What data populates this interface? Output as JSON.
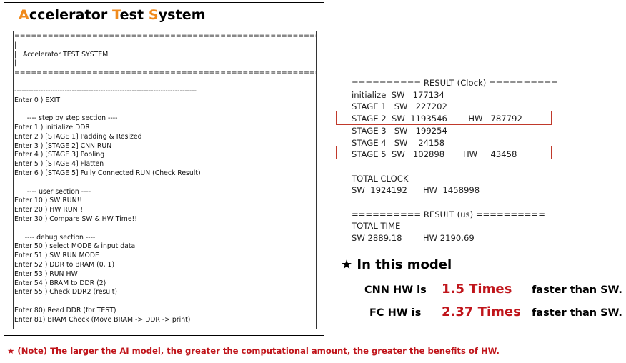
{
  "title": {
    "a": "A",
    "accelerator": "ccelerator ",
    "t": "T",
    "est": "est ",
    "s": "S",
    "ystem": "ystem"
  },
  "console": {
    "lines": [
      "==============================================================",
      "|",
      "|   Accelerator TEST SYSTEM",
      "|",
      "==============================================================",
      "",
      "----------------------------------------------------------------------------",
      "Enter 0 ) EXIT",
      "",
      "      ---- step by step section ----",
      "Enter 1 ) initialize DDR",
      "Enter 2 ) [STAGE 1] Padding & Resized",
      "Enter 3 ) [STAGE 2] CNN RUN",
      "Enter 4 ) [STAGE 3] Pooling",
      "Enter 5 ) [STAGE 4] Flatten",
      "Enter 6 ) [STAGE 5] Fully Connected RUN (Check Result)",
      "",
      "      ---- user section ----",
      "Enter 10 ) SW RUN!!",
      "Enter 20 ) HW RUN!!",
      "Enter 30 ) Compare SW & HW Time!!",
      "",
      "     ---- debug section ----",
      "Enter 50 ) select MODE & input data",
      "Enter 51 ) SW RUN MODE",
      "Enter 52 ) DDR to BRAM (0, 1)",
      "Enter 53 ) RUN HW",
      "Enter 54 ) BRAM to DDR (2)",
      "Enter 55 ) Check DDR2 (result)",
      "",
      "Enter 80) Read DDR (for TEST)",
      "Enter 81) BRAM Check (Move BRAM -> DDR -> print)"
    ]
  },
  "result": {
    "lines": [
      "========== RESULT (Clock) ==========",
      "initialize  SW   177134",
      "STAGE 1   SW   227202",
      "STAGE 2  SW  1193546        HW   787792",
      "STAGE 3   SW   199254",
      "STAGE 4   SW    24158",
      "STAGE 5  SW   102898       HW     43458",
      "",
      "TOTAL CLOCK",
      "SW  1924192      HW  1458998",
      "",
      "========== RESULT (us) ==========",
      "TOTAL TIME",
      "SW 2889.18        HW 2190.69"
    ],
    "highlight_color": "#c0392b"
  },
  "model": {
    "heading": "★ In this model",
    "rows": [
      {
        "label": "CNN HW is",
        "value": "1.5 Times",
        "tail": "faster than SW."
      },
      {
        "label": "FC   HW is",
        "value": "2.37 Times",
        "tail": "faster than SW."
      }
    ]
  },
  "note": "★ (Note) The larger the AI model, the greater the computational amount, the greater the benefits of HW.",
  "colors": {
    "accent_orange": "#f08a1c",
    "emphasis_red": "#c0151b"
  }
}
